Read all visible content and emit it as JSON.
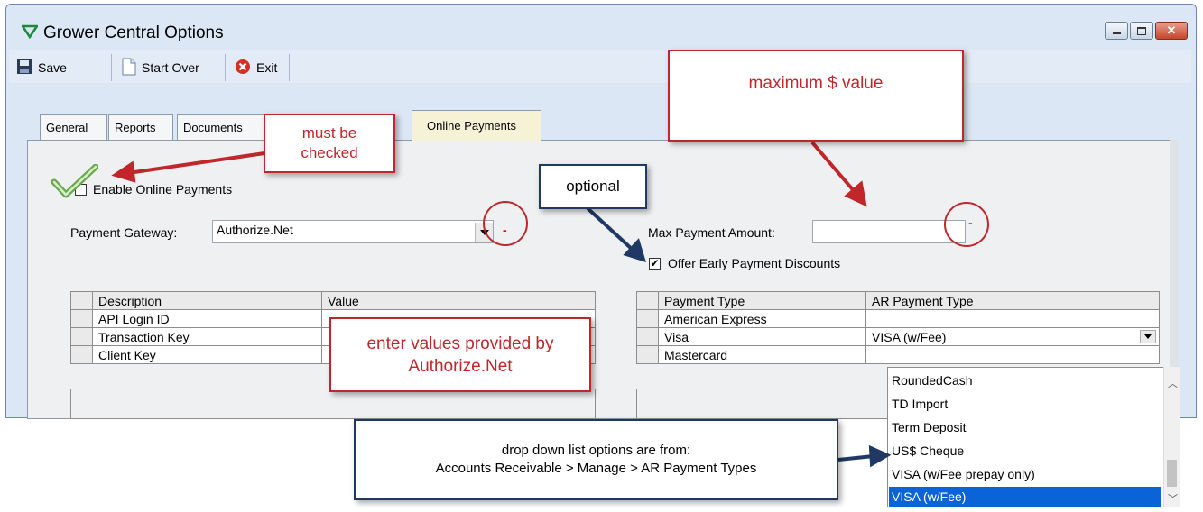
{
  "window": {
    "title": "Grower Central Options",
    "controls": [
      "minimize",
      "maximize",
      "close"
    ]
  },
  "toolbar": {
    "save_label": "Save",
    "start_over_label": "Start Over",
    "exit_label": "Exit"
  },
  "tabs": [
    {
      "label": "General"
    },
    {
      "label": "Reports"
    },
    {
      "label": "Documents"
    },
    {
      "label": "Online Payments",
      "active": true
    }
  ],
  "form": {
    "enable_online_payments_label": "Enable Online Payments",
    "enable_online_payments_checked": true,
    "payment_gateway_label": "Payment Gateway:",
    "payment_gateway_value": "Authorize.Net",
    "max_payment_amount_label": "Max Payment Amount:",
    "max_payment_amount_value": "",
    "offer_early_payment_discounts_label": "Offer Early Payment Discounts",
    "offer_early_payment_discounts_checked": true,
    "required_marker": "-"
  },
  "gateway_grid": {
    "headers": [
      "Description",
      "Value"
    ],
    "rows": [
      [
        "API Login ID",
        ""
      ],
      [
        "Transaction Key",
        ""
      ],
      [
        "Client Key",
        ""
      ]
    ]
  },
  "payment_type_grid": {
    "headers": [
      "Payment Type",
      "AR Payment Type"
    ],
    "rows": [
      [
        "American Express",
        ""
      ],
      [
        "Visa",
        "VISA (w/Fee)"
      ],
      [
        "Mastercard",
        ""
      ]
    ]
  },
  "dropdown": {
    "items": [
      "RoundedCash",
      "TD Import",
      "Term Deposit",
      "US$ Cheque",
      "VISA (w/Fee prepay only)",
      "VISA (w/Fee)"
    ],
    "selected": "VISA (w/Fee)"
  },
  "callouts": {
    "must_be_checked_line1": "must be",
    "must_be_checked_line2": "checked",
    "maximum_value": "maximum $ value",
    "optional": "optional",
    "enter_values_line1": "enter values provided by",
    "enter_values_line2": "Authorize.Net",
    "dropdown_source_line1": "drop down list options are from:",
    "dropdown_source_line2": "Accounts Receivable > Manage > AR Payment Types"
  },
  "colors": {
    "callout_red": "#c0262a",
    "callout_blue": "#1f3864",
    "selection_blue": "#0a64d8",
    "active_tab": "#f6f2d5"
  }
}
